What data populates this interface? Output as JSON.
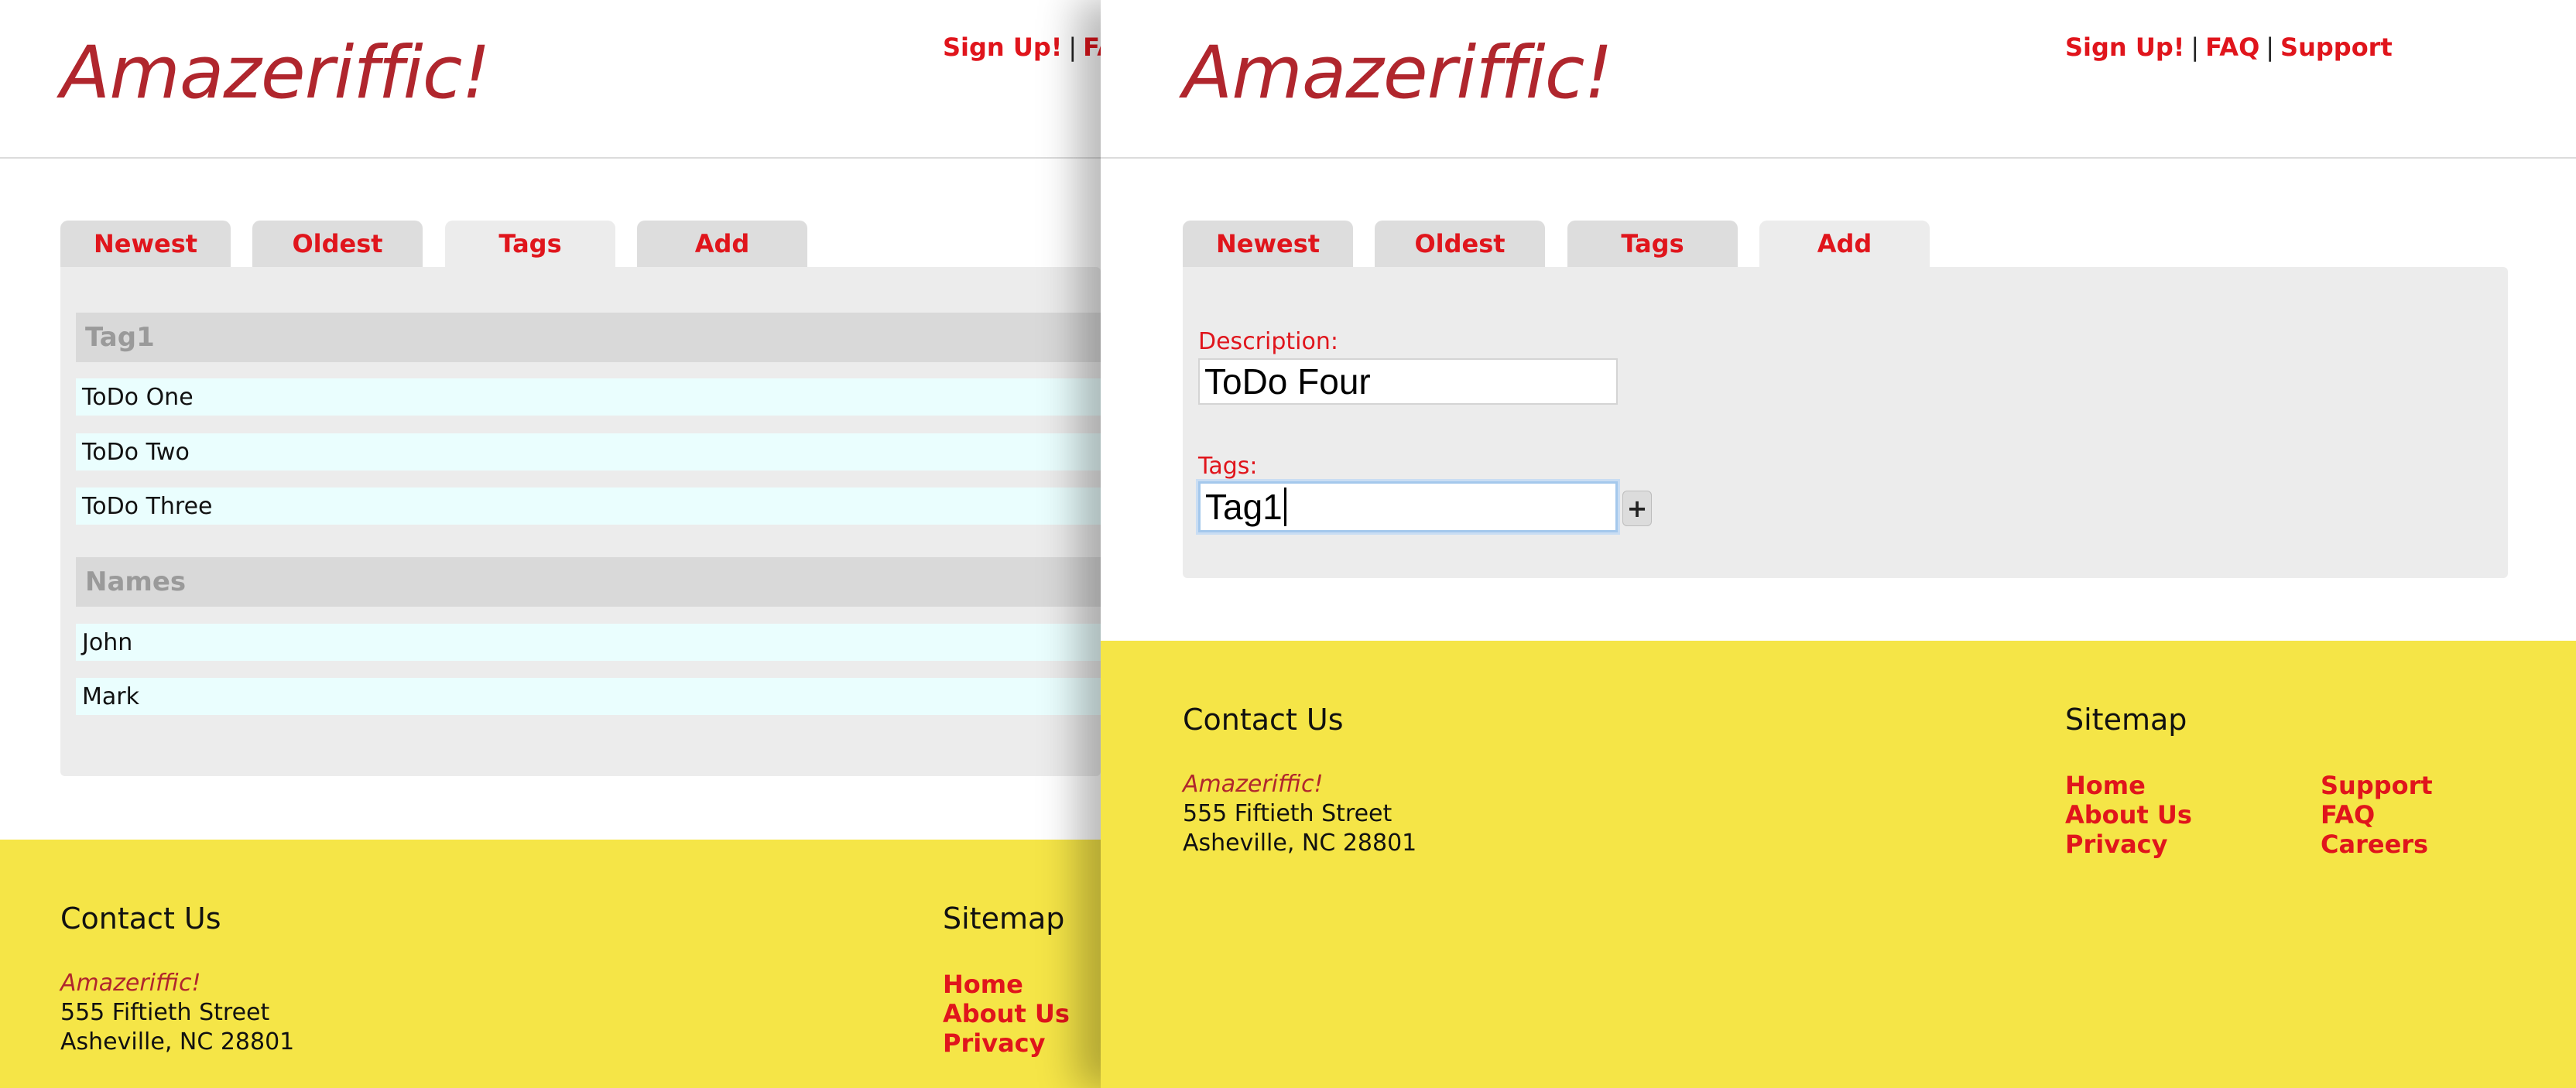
{
  "app": {
    "logo": "Amazeriffic!",
    "nav": {
      "signup": "Sign Up!",
      "faq": "FAQ",
      "support": "Support",
      "separator": "|",
      "faq_cropped": "FA"
    }
  },
  "tabs": [
    "Newest",
    "Oldest",
    "Tags",
    "Add"
  ],
  "left_window": {
    "active_tab": "Tags",
    "tag_groups": [
      {
        "name": "Tag1",
        "items": [
          "ToDo One",
          "ToDo Two",
          "ToDo Three"
        ]
      },
      {
        "name": "Names",
        "items": [
          "John",
          "Mark"
        ]
      }
    ]
  },
  "right_window": {
    "active_tab": "Add",
    "form": {
      "description_label": "Description:",
      "description_value": "ToDo Four",
      "tags_label": "Tags:",
      "tags_value": "Tag1",
      "add_button": "+"
    }
  },
  "footer": {
    "contact_heading": "Contact Us",
    "brand": "Amazeriffic!",
    "address_line1": "555 Fiftieth Street",
    "address_line2": "Asheville, NC 28801",
    "sitemap_heading": "Sitemap",
    "links_col1": [
      "Home",
      "About Us",
      "Privacy"
    ],
    "links_col2": [
      "Support",
      "FAQ",
      "Careers"
    ]
  },
  "colors": {
    "brand": "#b0262d",
    "link": "#e0151c",
    "footer_bg": "#f5e547",
    "panel_bg": "#ececec",
    "tab_bg": "#dddddd",
    "todo_bg": "#eafefe"
  }
}
